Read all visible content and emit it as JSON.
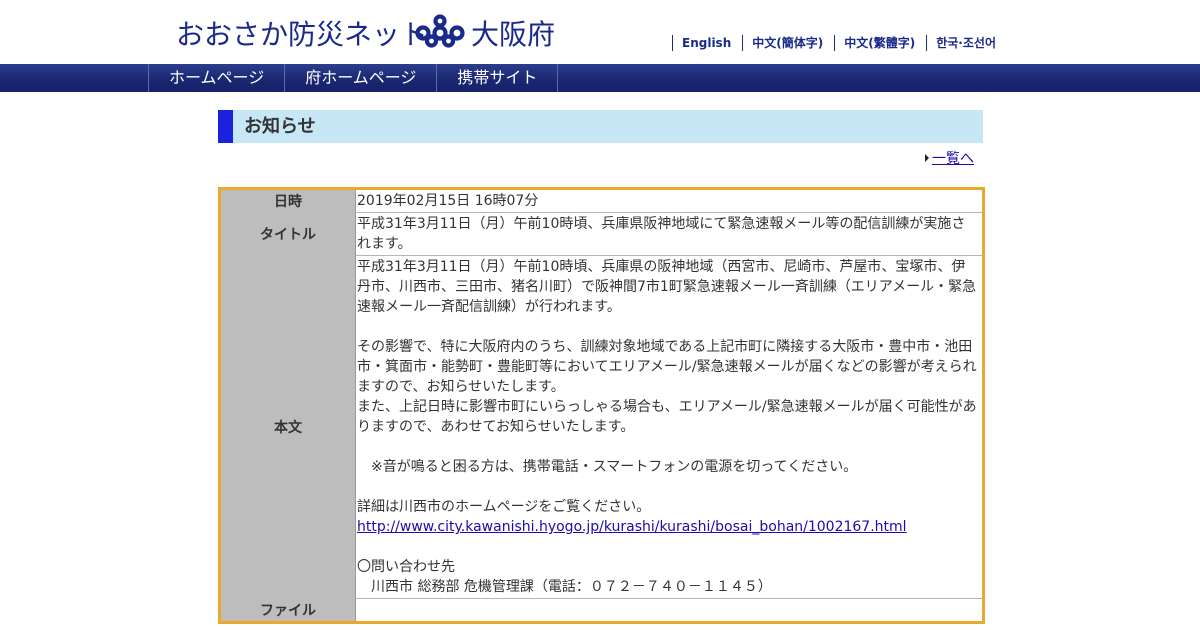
{
  "header": {
    "site_name": "おおさか防災ネット",
    "emblem_icon": "osaka-prefecture-emblem-icon",
    "pref_name": "大阪府",
    "languages": [
      "English",
      "中文(簡体字)",
      "中文(繁體字)",
      "한국·조선어"
    ]
  },
  "nav": {
    "items": [
      "ホームページ",
      "府ホームページ",
      "携帯サイト"
    ]
  },
  "notice": {
    "heading": "お知らせ",
    "back_link": "一覧へ"
  },
  "detail": {
    "date_label": "日時",
    "date_value": "2019年02月15日 16時07分",
    "title_label": "タイトル",
    "title_value": "平成31年3月11日（月）午前10時頃、兵庫県阪神地域にて緊急速報メール等の配信訓練が実施されます。",
    "body_label": "本文",
    "body": {
      "p1": "平成31年3月11日（月）午前10時頃、兵庫県の阪神地域（西宮市、尼崎市、芦屋市、宝塚市、伊丹市、川西市、三田市、猪名川町）で阪神間7市1町緊急速報メール一斉訓練（エリアメール・緊急速報メール一斉配信訓練）が行われます。",
      "p2": "その影響で、特に大阪府内のうち、訓練対象地域である上記市町に隣接する大阪市・豊中市・池田市・箕面市・能勢町・豊能町等においてエリアメール/緊急速報メールが届くなどの影響が考えられますので、お知らせいたします。",
      "p3": "また、上記日時に影響市町にいらっしゃる場合も、エリアメール/緊急速報メールが届く可能性がありますので、あわせてお知らせいたします。",
      "p4": "　※音が鳴ると困る方は、携帯電話・スマートフォンの電源を切ってください。",
      "p5": "詳細は川西市のホームページをご覧ください。",
      "link": "http://www.city.kawanishi.hyogo.jp/kurashi/kurashi/bosai_bohan/1002167.html",
      "contact_head": "〇問い合わせ先",
      "contact_body": "　川西市 総務部 危機管理課（電話：０７２－７４０－１１４５）"
    },
    "file_label": "ファイル",
    "file_value": ""
  },
  "colors": {
    "brand_navy": "#1a2a8a",
    "nav_bg": "#1a2670",
    "heading_bg": "#c7e6f6",
    "heading_bar": "#1a22e0",
    "table_border": "#e8a92c",
    "label_bg": "#bdbdbd",
    "link": "#1a0dab"
  }
}
